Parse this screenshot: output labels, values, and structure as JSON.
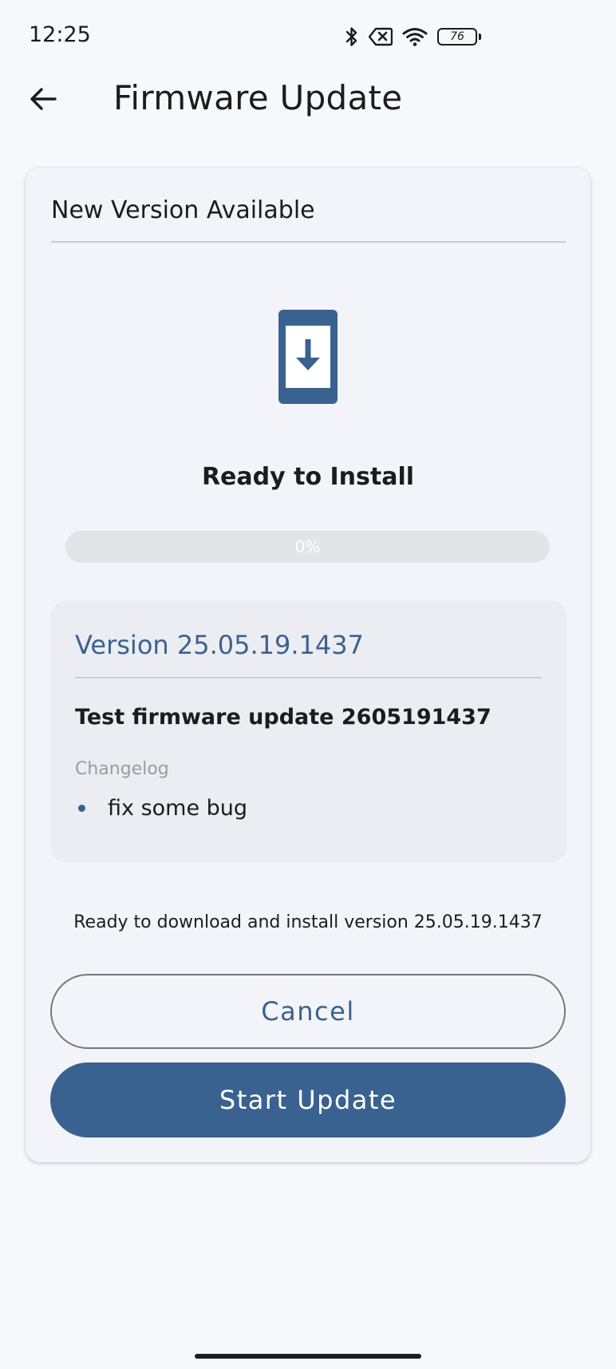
{
  "status_bar": {
    "time": "12:25",
    "icons": [
      "bluetooth-icon",
      "no-sim-icon",
      "wifi-icon",
      "battery-icon"
    ],
    "battery_level": "76"
  },
  "app_bar": {
    "back_icon": "arrow-back-icon",
    "title": "Firmware Update"
  },
  "card": {
    "title": "New Version Available",
    "device_icon": "phone-download-icon",
    "status_title": "Ready to Install",
    "progress": {
      "value": 0,
      "label": "0%"
    },
    "version": {
      "title": "Version 25.05.19.1437",
      "description": "Test firmware update 2605191437",
      "changelog_label": "Changelog",
      "changelog": [
        "fix some bug"
      ]
    },
    "message": "Ready to download and install version 25.05.19.1437",
    "cancel_label": "Cancel",
    "start_label": "Start Update"
  },
  "colors": {
    "primary": "#3a6290",
    "background": "#f7f8fc",
    "card": "#f3f4f9",
    "track": "#e3e4e8"
  }
}
